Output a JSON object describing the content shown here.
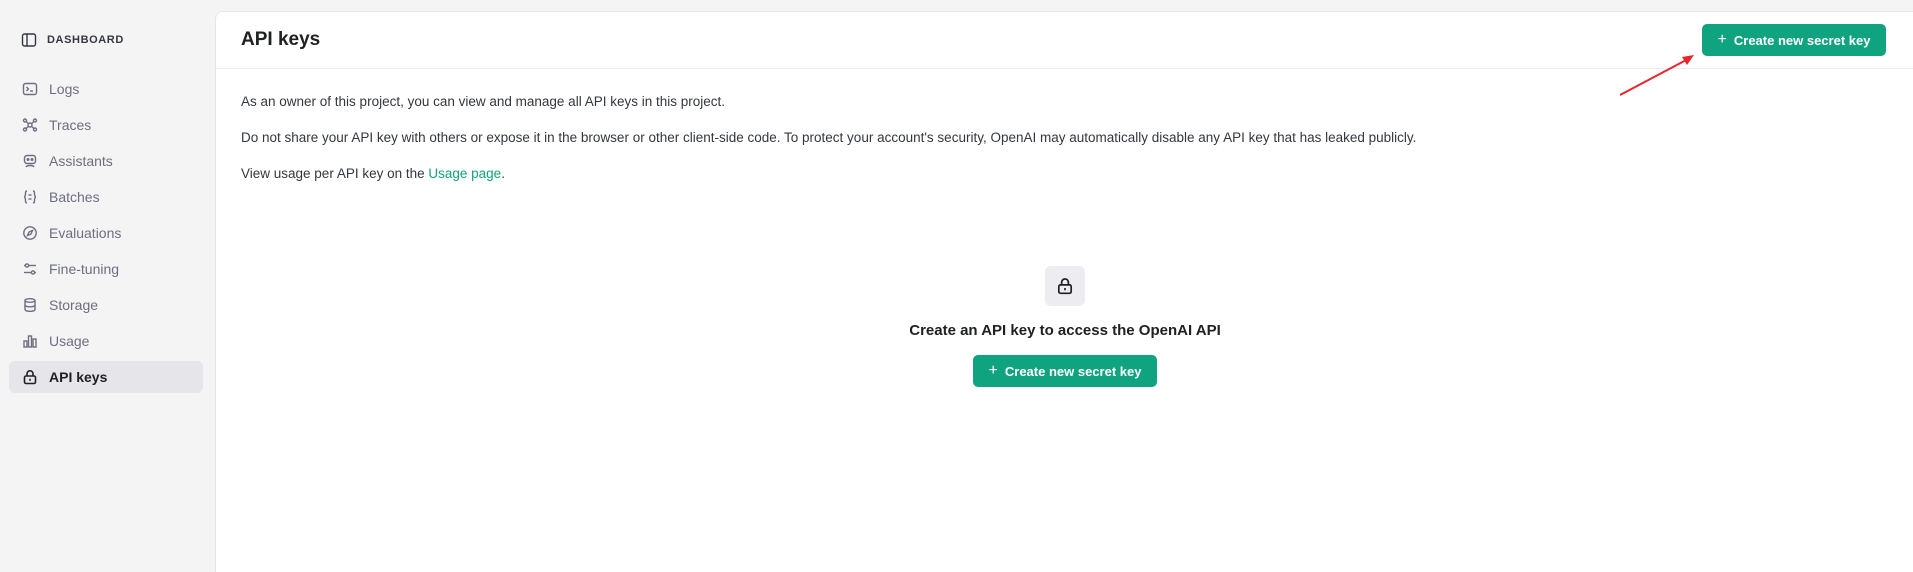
{
  "sidebar": {
    "header": {
      "label": "DASHBOARD",
      "icon": "sidebar-panel-icon"
    },
    "items": [
      {
        "label": "Logs",
        "icon": "terminal-icon"
      },
      {
        "label": "Traces",
        "icon": "traces-icon"
      },
      {
        "label": "Assistants",
        "icon": "robot-icon"
      },
      {
        "label": "Batches",
        "icon": "braces-icon"
      },
      {
        "label": "Evaluations",
        "icon": "compass-icon"
      },
      {
        "label": "Fine-tuning",
        "icon": "sliders-icon"
      },
      {
        "label": "Storage",
        "icon": "database-icon"
      },
      {
        "label": "Usage",
        "icon": "bar-chart-icon"
      },
      {
        "label": "API keys",
        "icon": "lock-icon",
        "active": true
      }
    ]
  },
  "header": {
    "title": "API keys",
    "create_button": "Create new secret key"
  },
  "content": {
    "para1": "As an owner of this project, you can view and manage all API keys in this project.",
    "para2": "Do not share your API key with others or expose it in the browser or other client-side code. To protect your account's security, OpenAI may automatically disable any API key that has leaked publicly.",
    "para3_prefix": "View usage per API key on the ",
    "para3_link": "Usage page",
    "para3_suffix": "."
  },
  "empty_state": {
    "icon": "lock-icon",
    "title": "Create an API key to access the OpenAI API",
    "button": "Create new secret key"
  },
  "colors": {
    "accent": "#10a37f",
    "annotation_arrow": "#e8262b"
  }
}
